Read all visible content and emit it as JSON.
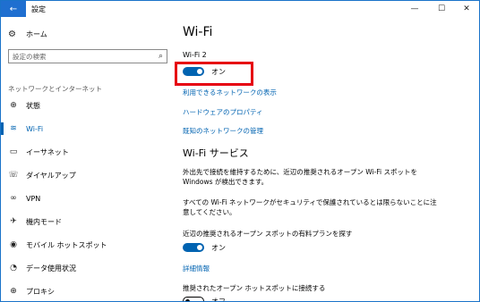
{
  "window": {
    "title": "設定",
    "back_glyph": "←",
    "controls": {
      "minimize": "—",
      "maximize": "☐",
      "close": "✕"
    }
  },
  "sidebar": {
    "home_label": "ホーム",
    "search_placeholder": "設定の検索",
    "section_label": "ネットワークとインターネット",
    "items": [
      {
        "label": "状態",
        "icon": "globe-icon",
        "selected": false
      },
      {
        "label": "Wi-Fi",
        "icon": "wifi-icon",
        "selected": true
      },
      {
        "label": "イーサネット",
        "icon": "ethernet-icon",
        "selected": false
      },
      {
        "label": "ダイヤルアップ",
        "icon": "dialup-icon",
        "selected": false
      },
      {
        "label": "VPN",
        "icon": "vpn-icon",
        "selected": false
      },
      {
        "label": "機内モード",
        "icon": "airplane-icon",
        "selected": false
      },
      {
        "label": "モバイル ホットスポット",
        "icon": "hotspot-icon",
        "selected": false
      },
      {
        "label": "データ使用状況",
        "icon": "data-usage-icon",
        "selected": false
      },
      {
        "label": "プロキシ",
        "icon": "proxy-icon",
        "selected": false
      }
    ]
  },
  "main": {
    "title": "Wi-Fi",
    "wifi_sub": "Wi-Fi 2",
    "wifi_toggle_state": "オン",
    "links": {
      "available_networks": "利用できるネットワークの表示",
      "hardware_properties": "ハードウェアのプロパティ",
      "manage_known": "既知のネットワークの管理"
    },
    "wifi_sense": {
      "title": "Wi-Fi サービス",
      "para1": "外出先で接続を維持するために、近辺の推奨されるオープン Wi-Fi スポットを Windows が検出できます。",
      "para2": "すべての Wi-Fi ネットワークがセキュリティで保護されているとは限らないことに注意してください。",
      "paid_plans_label": "近辺の推奨されるオープン スポットの有料プランを探す",
      "paid_plans_state": "オン",
      "details_link": "詳細情報",
      "connect_label": "推奨されたオープン ホットスポットに接続する",
      "connect_state": "オフ"
    }
  },
  "colors": {
    "accent": "#0063b1",
    "highlight": "#e60012",
    "titlebar_back": "#1f6fd0"
  }
}
